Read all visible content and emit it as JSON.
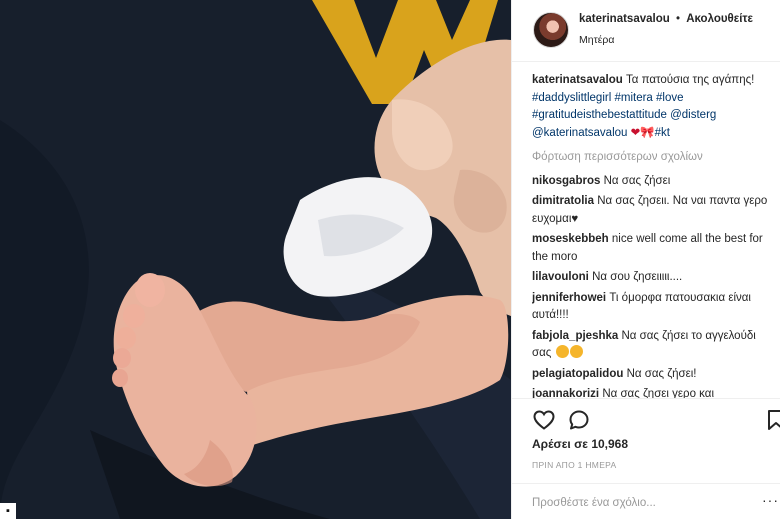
{
  "post": {
    "image_alt": "baby foot held in a hand",
    "corner_glyph": "▪"
  },
  "header": {
    "username": "katerinatsavalou",
    "separator": "•",
    "follow_label": "Ακολουθείτε",
    "location": "Μητέρα"
  },
  "caption": {
    "username": "katerinatsavalou",
    "text": "Τα πατούσια της αγάπης!",
    "tags": [
      "#daddyslittlegirl",
      "#mitera",
      "#love",
      "#gratitudeisthebestattitude",
      "@disterg",
      "@katerinatsavalou"
    ],
    "emoji_1": "❤",
    "emoji_2": "🎀",
    "last_tag": "#kt"
  },
  "load_more_label": "Φόρτωση περισσότερων σχολίων",
  "comments": [
    {
      "user": "nikosgabros",
      "text": "Να σας ζήσει"
    },
    {
      "user": "dimitratolia",
      "text": "Να σας ζησειι. Να ναι παντα γερο ευχομαι♥"
    },
    {
      "user": "moseskebbeh",
      "text": "nice well come all the best for the moro"
    },
    {
      "user": "lilavouloni",
      "text": "Να σου ζησειιιιι...."
    },
    {
      "user": "jenniferhowei",
      "text": "Τι όμορφα πατουσακια είναι αυτά!!!!"
    },
    {
      "user": "fabjola_pjeshka",
      "text": "Να σας ζήσει το αγγελούδι σας"
    },
    {
      "user": "pelagiatopalidou",
      "text": "Να σας ζήσει!"
    },
    {
      "user": "joannakorizi",
      "text": "Να σας ζησει γερο και"
    }
  ],
  "likes_label": "Αρέσει σε 10,968",
  "timestamp": "ΠΡΙΝ ΑΠΟ 1 ΗΜΕΡΑ",
  "comment_input": {
    "placeholder": "Προσθέστε ένα σχόλιο...",
    "more_label": "···"
  },
  "icons": {
    "like": "heart-icon",
    "comment": "comment-bubble-icon",
    "save": "bookmark-icon"
  },
  "colors": {
    "hashtag": "#003569",
    "muted": "#999999",
    "text": "#262626",
    "border": "#efefef"
  }
}
